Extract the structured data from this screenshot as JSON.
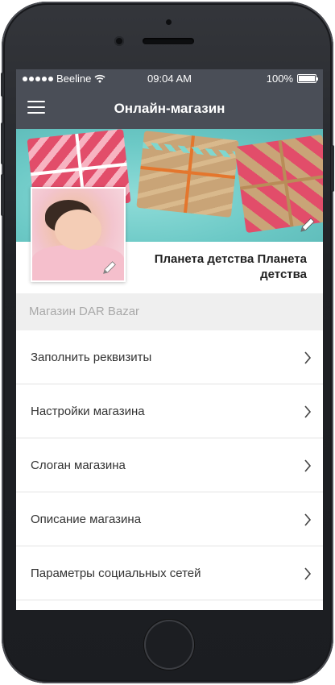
{
  "status_bar": {
    "carrier": "Beeline",
    "time": "09:04 AM",
    "battery": "100%"
  },
  "nav": {
    "title": "Онлайн-магазин"
  },
  "profile": {
    "shop_name": "Планета детства Планета детства"
  },
  "section": {
    "title": "Магазин DAR Bazar"
  },
  "menu": {
    "items": [
      {
        "label": "Заполнить реквизиты"
      },
      {
        "label": "Настройки магазина"
      },
      {
        "label": "Слоган магазина"
      },
      {
        "label": "Описание магазина"
      },
      {
        "label": "Параметры социальных сетей"
      }
    ]
  },
  "colors": {
    "nav_background": "#4a4e57",
    "section_background": "#efefef",
    "cover_teal": "#6cc9c6"
  },
  "icons": [
    "hamburger-icon",
    "wifi-icon",
    "battery-icon",
    "pencil-icon",
    "chevron-right-icon"
  ]
}
